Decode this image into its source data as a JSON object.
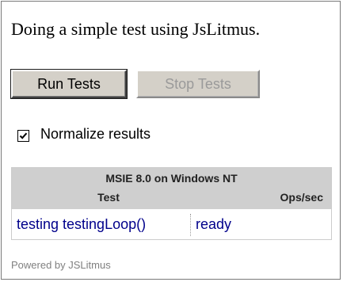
{
  "intro_text": "Doing a simple test using JsLitmus.",
  "buttons": {
    "run_label": "Run Tests",
    "stop_label": "Stop Tests",
    "stop_disabled": true
  },
  "normalize": {
    "label": "Normalize results",
    "checked": true
  },
  "results": {
    "platform": "MSIE 8.0 on Windows NT",
    "columns": [
      "Test",
      "Ops/sec"
    ],
    "rows": [
      {
        "test": "testing testingLoop()",
        "ops": "ready"
      }
    ]
  },
  "footer": {
    "powered_by": "Powered by JSLitmus"
  },
  "colors": {
    "link_text": "#00008b",
    "header_bg": "#cfcfcf",
    "button_face": "#d4d0c8",
    "disabled_text": "#9a9a9a",
    "footer_text": "#808080"
  },
  "icons": {
    "checkbox_mark": "check-icon"
  }
}
